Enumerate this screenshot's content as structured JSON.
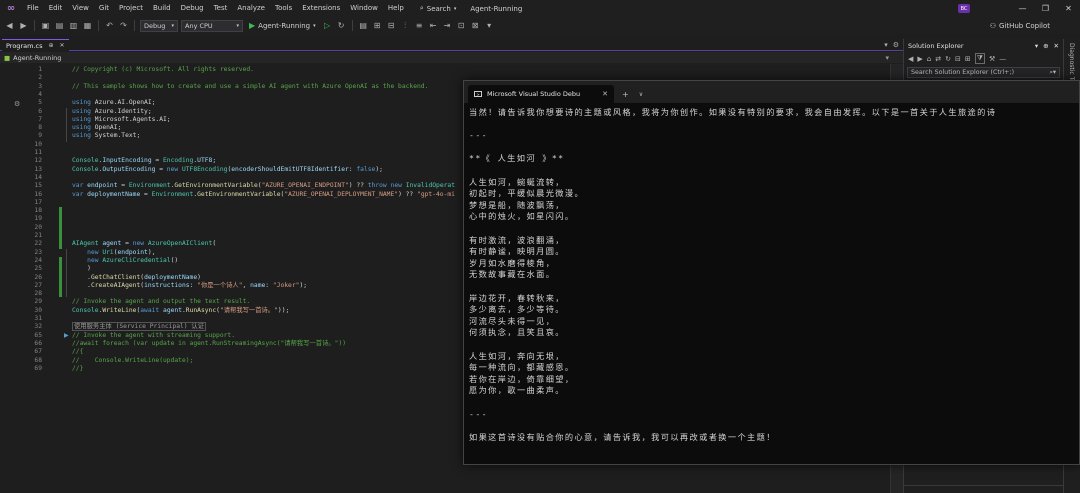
{
  "menubar": {
    "items": [
      "File",
      "Edit",
      "View",
      "Git",
      "Project",
      "Build",
      "Debug",
      "Test",
      "Analyze",
      "Tools",
      "Extensions",
      "Window",
      "Help"
    ],
    "search_label": "Search",
    "solution_name": "Agent-Running",
    "user_initials": "BC"
  },
  "toolbar": {
    "configuration": "Debug",
    "platform": "Any CPU",
    "run_label": "Agent-Running",
    "copilot_label": "GitHub Copilot"
  },
  "editor": {
    "tab_label": "Program.cs",
    "nav_project": "Agent-Running",
    "lines": [
      {
        "n": "1",
        "tokens": [
          [
            "cmt",
            "// Copyright (c) Microsoft. All rights reserved."
          ]
        ]
      },
      {
        "n": "2",
        "tokens": []
      },
      {
        "n": "3",
        "tokens": [
          [
            "cmt",
            "// This sample shows how to create and use a simple AI agent with Azure OpenAI as the backend."
          ]
        ]
      },
      {
        "n": "4",
        "tokens": []
      },
      {
        "n": "5",
        "tokens": [
          [
            "kw",
            "using"
          ],
          [
            "",
            " Azure.AI.OpenAI;"
          ]
        ]
      },
      {
        "n": "6",
        "tokens": [
          [
            "kw",
            "using"
          ],
          [
            "",
            " Azure.Identity;"
          ]
        ]
      },
      {
        "n": "7",
        "tokens": [
          [
            "kw",
            "using"
          ],
          [
            "",
            " Microsoft.Agents.AI;"
          ]
        ]
      },
      {
        "n": "8",
        "tokens": [
          [
            "kw",
            "using"
          ],
          [
            "",
            " OpenAI;"
          ]
        ]
      },
      {
        "n": "9",
        "tokens": [
          [
            "kw",
            "using"
          ],
          [
            "",
            " System.Text;"
          ]
        ]
      },
      {
        "n": "10",
        "tokens": []
      },
      {
        "n": "11",
        "tokens": []
      },
      {
        "n": "12",
        "tokens": [
          [
            "typ",
            "Console"
          ],
          [
            "",
            "."
          ],
          [
            "id",
            "InputEncoding"
          ],
          [
            "",
            " = "
          ],
          [
            "typ",
            "Encoding"
          ],
          [
            "",
            "."
          ],
          [
            "id",
            "UTF8"
          ],
          [
            "",
            ";"
          ]
        ]
      },
      {
        "n": "13",
        "tokens": [
          [
            "typ",
            "Console"
          ],
          [
            "",
            "."
          ],
          [
            "id",
            "OutputEncoding"
          ],
          [
            "",
            " = "
          ],
          [
            "kw",
            "new"
          ],
          [
            "",
            " "
          ],
          [
            "typ",
            "UTF8Encoding"
          ],
          [
            "",
            "("
          ],
          [
            "id",
            "encoderShouldEmitUTF8Identifier"
          ],
          [
            "",
            ": "
          ],
          [
            "kw",
            "false"
          ],
          [
            "",
            ");"
          ]
        ]
      },
      {
        "n": "14",
        "tokens": []
      },
      {
        "n": "15",
        "tokens": [
          [
            "kw",
            "var"
          ],
          [
            "",
            " "
          ],
          [
            "id",
            "endpoint"
          ],
          [
            "",
            " = "
          ],
          [
            "typ",
            "Environment"
          ],
          [
            "",
            "."
          ],
          [
            "mth",
            "GetEnvironmentVariable"
          ],
          [
            "",
            "("
          ],
          [
            "str",
            "\"AZURE_OPENAI_ENDPOINT\""
          ],
          [
            "",
            ") ?? "
          ],
          [
            "kw",
            "throw"
          ],
          [
            "",
            " "
          ],
          [
            "kw",
            "new"
          ],
          [
            "",
            " "
          ],
          [
            "typ",
            "InvalidOperat"
          ]
        ]
      },
      {
        "n": "16",
        "tokens": [
          [
            "kw",
            "var"
          ],
          [
            "",
            " "
          ],
          [
            "id",
            "deploymentName"
          ],
          [
            "",
            " = "
          ],
          [
            "typ",
            "Environment"
          ],
          [
            "",
            "."
          ],
          [
            "mth",
            "GetEnvironmentVariable"
          ],
          [
            "",
            "("
          ],
          [
            "str",
            "\"AZURE_OPENAI_DEPLOYMENT_NAME\""
          ],
          [
            "",
            ") ?? "
          ],
          [
            "str",
            "\"gpt-4o-mi"
          ]
        ]
      },
      {
        "n": "17",
        "tokens": []
      },
      {
        "n": "18",
        "tokens": []
      },
      {
        "n": "19",
        "tokens": []
      },
      {
        "n": "20",
        "tokens": []
      },
      {
        "n": "21",
        "tokens": []
      },
      {
        "n": "22",
        "tokens": [
          [
            "typ",
            "AIAgent"
          ],
          [
            "",
            " "
          ],
          [
            "id",
            "agent"
          ],
          [
            "",
            " = "
          ],
          [
            "kw",
            "new"
          ],
          [
            "",
            " "
          ],
          [
            "typ",
            "AzureOpenAIClient"
          ],
          [
            "",
            "("
          ]
        ]
      },
      {
        "n": "23",
        "tokens": [
          [
            "",
            "    "
          ],
          [
            "kw",
            "new"
          ],
          [
            "",
            " "
          ],
          [
            "typ",
            "Uri"
          ],
          [
            "",
            "("
          ],
          [
            "id",
            "endpoint"
          ],
          [
            "",
            "),"
          ]
        ]
      },
      {
        "n": "24",
        "tokens": [
          [
            "",
            "    "
          ],
          [
            "kw",
            "new"
          ],
          [
            "",
            " "
          ],
          [
            "typ",
            "AzureCliCredential"
          ],
          [
            "",
            "()"
          ]
        ]
      },
      {
        "n": "25",
        "tokens": [
          [
            "",
            "    )"
          ]
        ]
      },
      {
        "n": "26",
        "tokens": [
          [
            "",
            "    ."
          ],
          [
            "mth",
            "GetChatClient"
          ],
          [
            "",
            "("
          ],
          [
            "id",
            "deploymentName"
          ],
          [
            "",
            ")"
          ]
        ]
      },
      {
        "n": "27",
        "tokens": [
          [
            "",
            "    ."
          ],
          [
            "mth",
            "CreateAIAgent"
          ],
          [
            "",
            "("
          ],
          [
            "id",
            "instructions"
          ],
          [
            "",
            ": "
          ],
          [
            "str",
            "\"你是一个诗人\""
          ],
          [
            "",
            ", "
          ],
          [
            "id",
            "name"
          ],
          [
            "",
            ": "
          ],
          [
            "str",
            "\"Joker\""
          ],
          [
            "",
            ");"
          ]
        ]
      },
      {
        "n": "28",
        "tokens": []
      },
      {
        "n": "29",
        "tokens": [
          [
            "cmt",
            "// Invoke the agent and output the text result."
          ]
        ]
      },
      {
        "n": "30",
        "tokens": [
          [
            "typ",
            "Console"
          ],
          [
            "",
            "."
          ],
          [
            "mth",
            "WriteLine"
          ],
          [
            "",
            "("
          ],
          [
            "kw",
            "await"
          ],
          [
            "",
            " "
          ],
          [
            "id",
            "agent"
          ],
          [
            "",
            "."
          ],
          [
            "mth",
            "RunAsync"
          ],
          [
            "",
            "("
          ],
          [
            "str",
            "\"请帮我写一首诗。\""
          ],
          [
            "",
            "));"
          ]
        ]
      },
      {
        "n": "31",
        "tokens": []
      },
      {
        "n": "32",
        "tokens": [
          [
            "box",
            "使用服务主体 (Service Principal) 认证"
          ]
        ]
      },
      {
        "n": "65",
        "tokens": [
          [
            "cmt",
            "// Invoke the agent with streaming support."
          ]
        ]
      },
      {
        "n": "66",
        "tokens": [
          [
            "cmt",
            "//await foreach (var update in agent.RunStreamingAsync(\"请帮我写一首诗。\"))"
          ]
        ]
      },
      {
        "n": "67",
        "tokens": [
          [
            "cmt",
            "//{"
          ]
        ]
      },
      {
        "n": "68",
        "tokens": [
          [
            "cmt",
            "//    Console.WriteLine(update);"
          ]
        ]
      },
      {
        "n": "69",
        "tokens": [
          [
            "cmt",
            "//}"
          ]
        ]
      }
    ]
  },
  "solution_explorer": {
    "title": "Solution Explorer",
    "search_placeholder": "Search Solution Explorer (Ctrl+;)",
    "diagnostic_label": "Diagnostic To..."
  },
  "console": {
    "tab_title": "Microsoft Visual Studio Debu",
    "lines": [
      "当然！请告诉我你想要诗的主题或风格，我将为你创作。如果没有特别的要求，我会自由发挥。以下是一首关于人生旅途的诗",
      "",
      "---",
      "",
      "**《 人生如河 》**",
      "",
      "人生如河，蜿蜒流转，",
      "初起时，平缓似晨光微漫。",
      "梦想是船，随波飘荡，",
      "心中的烛火，如星闪闪。",
      "",
      "有时激流，波浪翻涌，",
      "有时静谧，映明月圆。",
      "岁月如水磨得棱角，",
      "无数故事藏在水面。",
      "",
      "岸边花开，春转秋来，",
      "多少离去，多少等待。",
      "河流尽头未得一见，",
      "何须执念，且笑且哀。",
      "",
      "人生如河，奔向无垠，",
      "每一种流向，都藏感恩。",
      "若你在岸边，倚靠细望，",
      "愿为你，歌一曲柔声。",
      "",
      "---",
      "",
      "如果这首诗没有贴合你的心意，请告诉我，我可以再改或者换一个主题！"
    ]
  }
}
